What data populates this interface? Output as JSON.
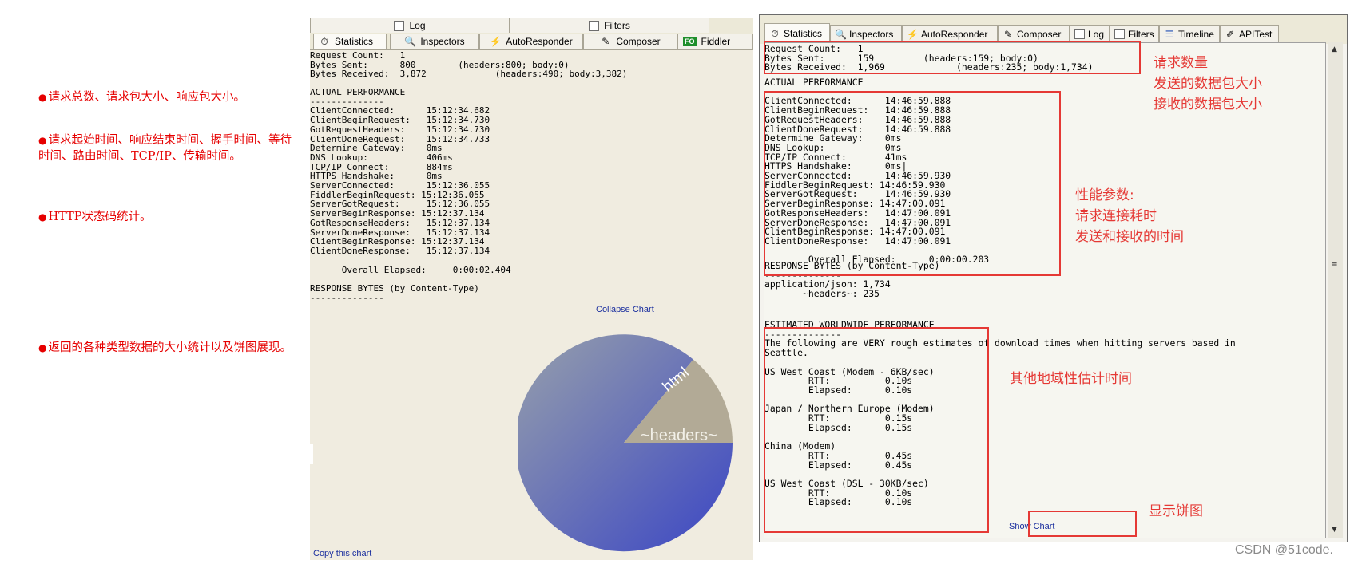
{
  "notes": [
    "请求总数、请求包大小、响应包大小。",
    "请求起始时间、响应结束时间、握手时间、等待时间、路由时间、TCP/IP、传输时间。",
    "HTTP状态码统计。",
    "返回的各种类型数据的大小统计以及饼图展现。"
  ],
  "left": {
    "tabs_row1": [
      "Log",
      "Filters"
    ],
    "tabs_row2": [
      "Statistics",
      "Inspectors",
      "AutoResponder",
      "Composer",
      "Fiddler"
    ],
    "fo_badge": "FO",
    "summary": "Request Count:   1\nBytes Sent:      800        (headers:800; body:0)\nBytes Received:  3,872             (headers:490; body:3,382)",
    "performance": "ACTUAL PERFORMANCE\n--------------\nClientConnected:      15:12:34.682\nClientBeginRequest:   15:12:34.730\nGotRequestHeaders:    15:12:34.730\nClientDoneRequest:    15:12:34.733\nDetermine Gateway:    0ms\nDNS Lookup:           406ms\nTCP/IP Connect:       884ms\nHTTPS Handshake:      0ms\nServerConnected:      15:12:36.055\nFiddlerBeginRequest: 15:12:36.055\nServerGotRequest:     15:12:36.055\nServerBeginResponse: 15:12:37.134\nGotResponseHeaders:   15:12:37.134\nServerDoneResponse:   15:12:37.134\nClientBeginResponse: 15:12:37.134\nClientDoneResponse:   15:12:37.134",
    "elapsed": "      Overall Elapsed:     0:00:02.404",
    "response_bytes": "RESPONSE BYTES (by Content-Type)\n--------------",
    "collapse_chart": "Collapse Chart",
    "copy_chart": "Copy this chart",
    "pie_labels": [
      "html",
      "~headers~"
    ]
  },
  "right": {
    "tabs": [
      "Statistics",
      "Inspectors",
      "AutoResponder",
      "Composer",
      "Log",
      "Filters",
      "Timeline",
      "APITest"
    ],
    "summary": "Request Count:   1\nBytes Sent:      159         (headers:159; body:0)\nBytes Received:  1,969             (headers:235; body:1,734)",
    "performance": "ACTUAL PERFORMANCE\n--------------\nClientConnected:      14:46:59.888\nClientBeginRequest:   14:46:59.888\nGotRequestHeaders:    14:46:59.888\nClientDoneRequest:    14:46:59.888\nDetermine Gateway:    0ms\nDNS Lookup:           0ms\nTCP/IP Connect:       41ms\nHTTPS Handshake:      0ms|\nServerConnected:      14:46:59.930\nFiddlerBeginRequest: 14:46:59.930\nServerGotRequest:     14:46:59.930\nServerBeginResponse: 14:47:00.091\nGotResponseHeaders:   14:47:00.091\nServerDoneResponse:   14:47:00.091\nClientBeginResponse: 14:47:00.091\nClientDoneResponse:   14:47:00.091\n\n        Overall Elapsed:      0:00:00.203",
    "response_bytes": "RESPONSE BYTES (by Content-Type)\n--------------\napplication/json: 1,734\n       ~headers~: 235",
    "worldwide": "ESTIMATED WORLDWIDE PERFORMANCE\n--------------\nThe following are VERY rough estimates of download times when hitting servers based in\nSeattle.\n\nUS West Coast (Modem - 6KB/sec)\n        RTT:          0.10s\n        Elapsed:      0.10s\n\nJapan / Northern Europe (Modem)\n        RTT:          0.15s\n        Elapsed:      0.15s\n\nChina (Modem)\n        RTT:          0.45s\n        Elapsed:      0.45s\n\nUS West Coast (DSL - 30KB/sec)\n        RTT:          0.10s\n        Elapsed:      0.10s",
    "show_chart": "Show Chart",
    "annotations": {
      "request": "请求数量\n发送的数据包大小\n接收的数据包大小",
      "performance": "性能参数:\n请求连接耗时\n发送和接收的时间",
      "regional": "其他地域性估计时间",
      "pie": "显示饼图"
    }
  },
  "watermark": "CSDN @51code.",
  "colors": {
    "annotation_red": "#e53935",
    "pie_blue": "#3f51b5",
    "pie_grey": "#b2aa96"
  }
}
